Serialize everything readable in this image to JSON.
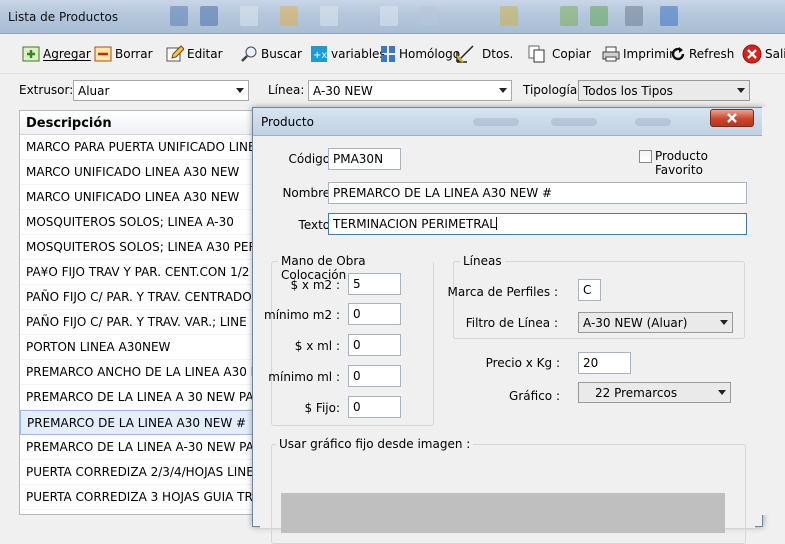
{
  "window": {
    "title": "Lista de Productos"
  },
  "toolbar": {
    "agregar": "Agregar",
    "borrar": "Borrar",
    "editar": "Editar",
    "buscar": "Buscar",
    "variables": "variables",
    "homologo": "Homólogo",
    "dtos": "Dtos.",
    "copiar": "Copiar",
    "imprimir": "Imprimir",
    "refresh": "Refresh",
    "salir": "Sali"
  },
  "filters": {
    "extrusor_label": "Extrusor:",
    "extrusor_value": "Aluar",
    "linea_label": "Línea:",
    "linea_value": "A-30 NEW",
    "tipologia_label": "Tipología:",
    "tipologia_value": "Todos los Tipos"
  },
  "list": {
    "header": "Descripción",
    "rows": [
      "MARCO PARA PUERTA UNIFICADO LINEA",
      "MARCO UNIFICADO LINEA A30 NEW",
      "MARCO UNIFICADO LINEA A30 NEW",
      "MOSQUITEROS SOLOS; LINEA A-30",
      "MOSQUITEROS SOLOS; LINEA A30 PER",
      "PA¥O FIJO TRAV Y PAR. CENT.CON 1/2",
      "PAÑO FIJO C/  PAR. Y TRAV. CENTRADO",
      "PAÑO FIJO C/  PAR. Y TRAV. VAR.; LINE",
      "PORTON LINEA A30NEW",
      "PREMARCO ANCHO DE LA LINEA A30 NEW",
      "PREMARCO DE LA LINEA A 30 NEW PAR",
      "PREMARCO DE LA LINEA A30 NEW  #",
      "PREMARCO DE LA LINEA A-30 NEW  PA",
      "PUERTA CORREDIZA 2/3/4/HOJAS LINEA",
      "PUERTA CORREDIZA 3 HOJAS GUIA TRI"
    ],
    "selected_index": 11
  },
  "dialog": {
    "title": "Producto",
    "codigo_label": "Código :",
    "codigo_value": "PMA30N",
    "favorito_label": "Producto Favorito",
    "nombre_label": "Nombre :",
    "nombre_value": "PREMARCO DE LA LINEA A30 NEW  #",
    "texto_label": "Texto :",
    "texto_value": "TERMINACION PERIMETRAL",
    "mano_obra": {
      "title": "Mano de Obra Colocación",
      "xm2_label": "$ x m2 :",
      "xm2_value": "5",
      "min_m2_label": "mínimo m2 :",
      "min_m2_value": "0",
      "xml_label": "$ x ml :",
      "xml_value": "0",
      "min_ml_label": "mínimo ml :",
      "min_ml_value": "0",
      "fijo_label": "$ Fijo:",
      "fijo_value": "0"
    },
    "lineas": {
      "title": "Líneas",
      "marca_label": "Marca de Perfiles :",
      "marca_value": "C",
      "filtro_label": "Filtro  de Línea :",
      "filtro_value": "A-30 NEW (Aluar)"
    },
    "precio_label": "Precio x Kg :",
    "precio_value": "20",
    "grafico_label": "Gráfico :",
    "grafico_value": "22 Premarcos",
    "usar_grafico_label": "Usar gráfico fijo desde imagen :"
  }
}
